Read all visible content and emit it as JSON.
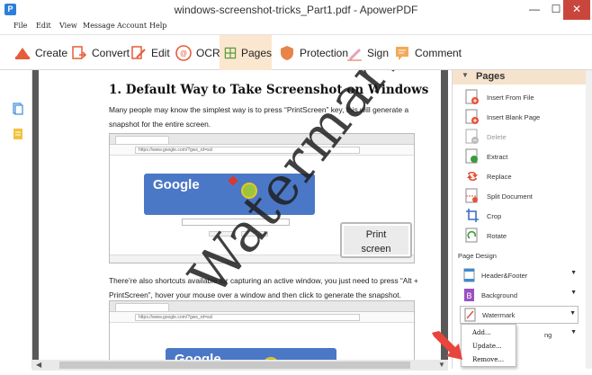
{
  "window": {
    "title": "windows-screenshot-tricks_Part1.pdf - ApowerPDF",
    "app_icon_letter": "P",
    "minimize": "—",
    "maximize": "☐",
    "close": "✕"
  },
  "menu": [
    "File",
    "Edit",
    "View",
    "Message",
    "Account",
    "Help"
  ],
  "toolbar": {
    "tools": [
      {
        "label": "Create",
        "icon": "create-icon"
      },
      {
        "label": "Convert",
        "icon": "convert-icon"
      },
      {
        "label": "Edit",
        "icon": "edit-icon"
      },
      {
        "label": "OCR",
        "icon": "ocr-icon"
      },
      {
        "label": "Pages",
        "icon": "pages-icon",
        "active": true
      },
      {
        "label": "Protection",
        "icon": "shield-icon"
      },
      {
        "label": "Sign",
        "icon": "sign-icon"
      },
      {
        "label": "Comment",
        "icon": "comment-icon"
      }
    ]
  },
  "document": {
    "heading": "1. Default Way to Take Screenshot on Windows",
    "para1": "Many people may know the simplest way is to press “PrintScreen” key, this will generate a snapshot for the entire screen.",
    "para2": "There’re also shortcuts available for capturing an active window, you just need to press “Alt + PrintScreen”, hover your mouse over a window and then click to generate the snapshot.",
    "screenshot1": {
      "url": "https://www.google.com/?gws_rd=ssl",
      "doodle": "Google",
      "key_label_line1": "Print",
      "key_label_line2": "screen"
    },
    "screenshot2": {
      "url": "https://www.google.com/?gws_rd=ssl",
      "doodle": "Google"
    },
    "watermark": "Watermark"
  },
  "right_panel": {
    "header": "Pages",
    "page_items": [
      {
        "label": "Insert From File",
        "icon": "insert-file-icon",
        "enabled": true
      },
      {
        "label": "Insert Blank Page",
        "icon": "blank-page-icon",
        "enabled": true
      },
      {
        "label": "Delete",
        "icon": "delete-page-icon",
        "enabled": false
      },
      {
        "label": "Extract",
        "icon": "extract-icon",
        "enabled": true
      },
      {
        "label": "Replace",
        "icon": "replace-icon",
        "enabled": true
      },
      {
        "label": "Split Document",
        "icon": "split-icon",
        "enabled": true
      },
      {
        "label": "Crop",
        "icon": "crop-icon",
        "enabled": true
      },
      {
        "label": "Rotate",
        "icon": "rotate-icon",
        "enabled": true
      }
    ],
    "section_title": "Page Design",
    "design_items": [
      {
        "label": "Header&Footer",
        "icon": "header-footer-icon"
      },
      {
        "label": "Background",
        "icon": "background-icon"
      },
      {
        "label": "Watermark",
        "icon": "watermark-icon"
      },
      {
        "label": "ng",
        "icon": "numbering-icon"
      }
    ],
    "watermark_menu": [
      "Add...",
      "Update...",
      "Remove..."
    ]
  },
  "colors": {
    "accent": "#f6e3ce",
    "close_button": "#c9463d",
    "arrow": "#e8453c"
  }
}
